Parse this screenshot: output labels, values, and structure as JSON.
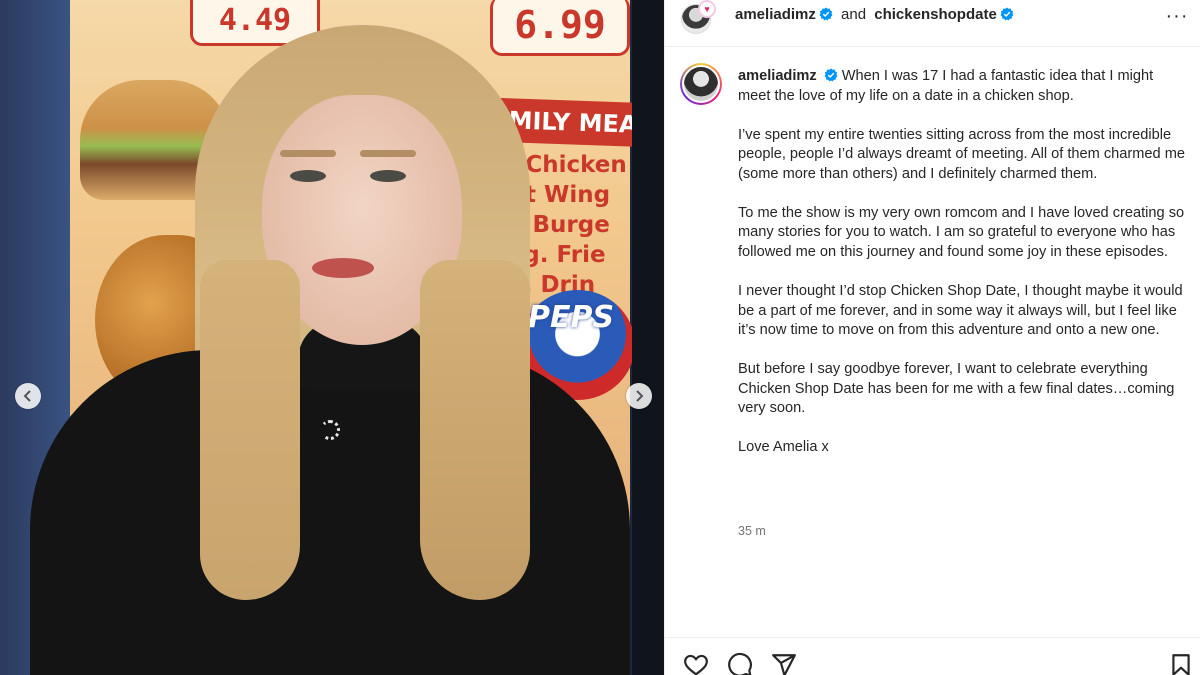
{
  "post": {
    "image_alt_subject": "",
    "menu_sign": {
      "price_1": "4.49",
      "price_2": "6.99",
      "banner": "AMILY MEA",
      "items": [
        "cs Chicken",
        "Hot Wing",
        "let Burge",
        "Reg. Frie",
        "Ltr. Drin"
      ],
      "brand": "PEPS"
    }
  },
  "header": {
    "user_1": "ameliadimz",
    "conjunction": "and",
    "user_2": "chickenshopdate",
    "more_label": "···"
  },
  "caption": {
    "username": "ameliadimz",
    "paragraphs": [
      "When I was 17 I had a fantastic idea that I might meet the love of my life on a date in a chicken shop.",
      "I’ve spent my entire twenties sitting across from the most incredible people, people I’d always dreamt of meeting. All of them charmed me (some more than others) and I definitely charmed them.",
      "To me the show is my very own romcom and I have loved creating so many stories for you to watch. I am so grateful to everyone who has followed me on this journey and found some joy in these episodes.",
      "I never thought I’d stop Chicken Shop Date, I thought maybe it would be a part of me forever, and in some way it always will, but I feel like it’s now time to move on from this adventure and onto a new one.",
      "But before I say goodbye forever, I want to celebrate everything Chicken Shop Date has been for me with a few final dates…coming very soon.",
      "Love Amelia x"
    ],
    "timestamp": "35 m"
  },
  "icons": {
    "verified": "verified-badge-icon",
    "like": "heart-icon",
    "comment": "comment-icon",
    "share": "paper-plane-icon",
    "save": "bookmark-icon",
    "prev": "chevron-left-icon",
    "next": "chevron-right-icon"
  },
  "colors": {
    "verified_blue": "#0095f6",
    "text": "#262626",
    "muted": "#737373",
    "divider": "#efefef"
  }
}
